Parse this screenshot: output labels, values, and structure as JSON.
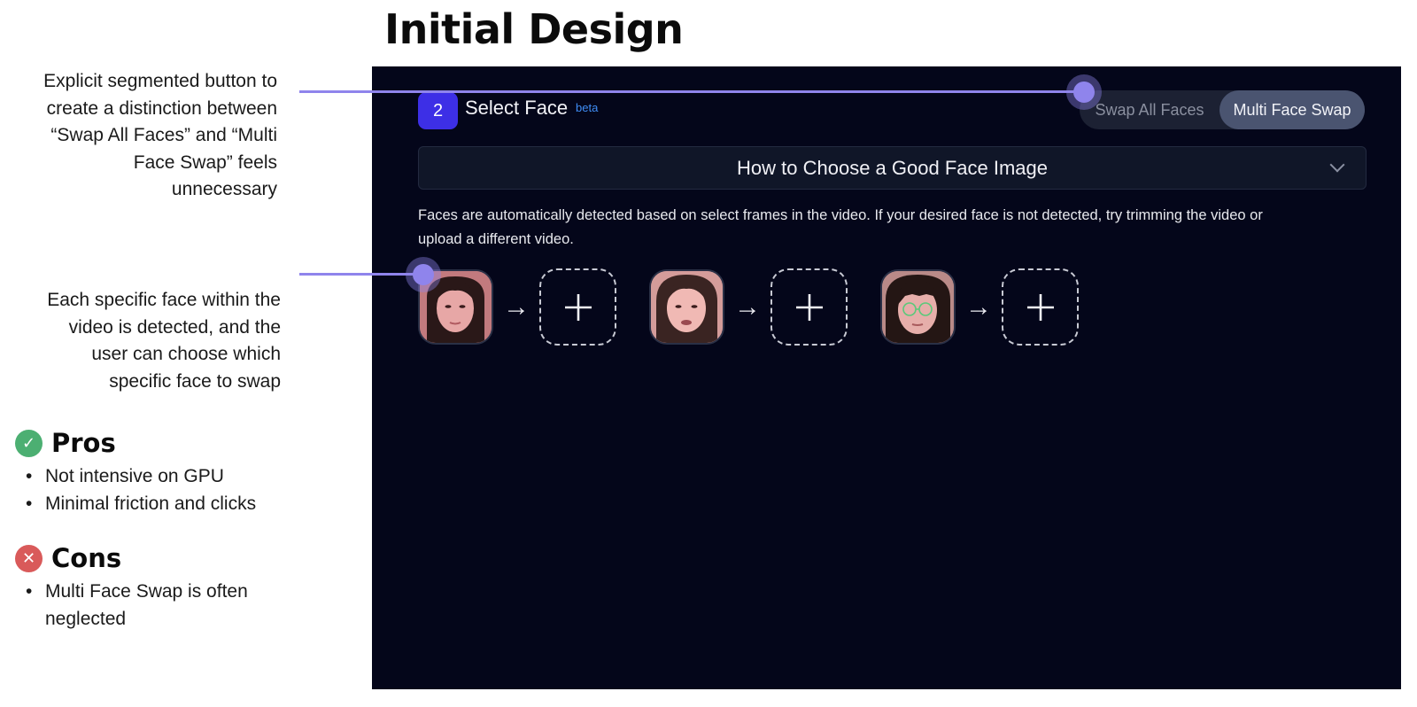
{
  "page": {
    "title": "Initial Design"
  },
  "annotations": [
    {
      "lines": [
        "Explicit segmented button to",
        "create a distinction between",
        "“Swap All Faces” and “Multi",
        "Face Swap” feels",
        "unnecessary"
      ]
    },
    {
      "lines": [
        "Each specific face within the",
        "video is detected, and the",
        "user can choose which",
        "specific face to swap"
      ]
    }
  ],
  "pros": {
    "icon": "check-icon",
    "title": "Pros",
    "items": [
      "Not intensive on GPU",
      "Minimal friction and clicks"
    ]
  },
  "cons": {
    "icon": "close-icon",
    "title": "Cons",
    "items": [
      "Multi Face Swap is often",
      "neglected"
    ]
  },
  "panel": {
    "step_number": "2",
    "step_title": "Select Face",
    "badge": "beta",
    "segmented": {
      "options": [
        "Swap All Faces",
        "Multi Face Swap"
      ],
      "selected": "Multi Face Swap"
    },
    "accordion": {
      "title": "How to Choose a Good Face Image",
      "icon": "chevron-down-icon"
    },
    "description_lines": [
      "Faces are automatically detected based on select frames in the video. If your desired face is not detected, try trimming the video or",
      "upload a different video."
    ],
    "faces": [
      {
        "arrow": "→",
        "add": "+"
      },
      {
        "arrow": "→",
        "add": "+"
      },
      {
        "arrow": "→",
        "add": "+"
      }
    ]
  },
  "colors": {
    "accent": "#3d2fe6",
    "pointer": "#8f84ec",
    "panel_bg": "#04061a",
    "pros": "#4caf72",
    "cons": "#d95a5a",
    "badge": "#3f8df5"
  }
}
